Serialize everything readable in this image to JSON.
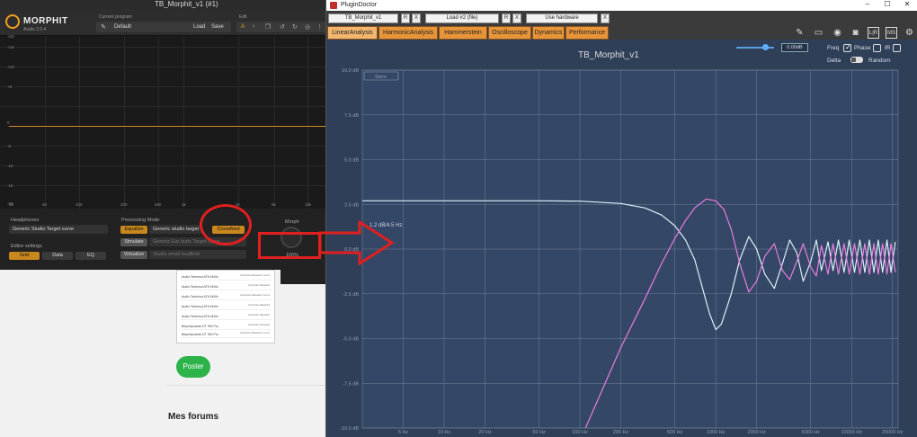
{
  "morphit": {
    "window_title": "TB_Morphit_v1 (#1)",
    "brand": "MORPHIT",
    "version": "Audio 2.0.4",
    "current_program_label": "Current program",
    "program_value": "Default",
    "load_label": "Load",
    "save_label": "Save",
    "edit_label": "Edit",
    "edit_a": "A",
    "graph": {
      "y_labels": [
        "+20",
        "+15",
        "+10",
        "+5",
        "0",
        "-5",
        "-10",
        "-15",
        "-20"
      ],
      "x_labels": [
        "20",
        "50",
        "100",
        "200",
        "500",
        "1k",
        "2k",
        "5k",
        "10k"
      ]
    },
    "headphones_label": "Headphones",
    "headphones_value": "Generic Studio Target curve",
    "processing_mode_label": "Processing Mode",
    "equalize_label": "Equalize",
    "equalize_value": "Generic studio target",
    "crossfeed_label": "Crossfeed",
    "simulate_label": "Simulate",
    "simulate_value": "Generic Ear buds Target curve",
    "virtualize_label": "Virtualize",
    "virtualize_value": "Studio small loudfield",
    "morph_label": "Morph",
    "morph_value": "100%",
    "editor_settings_label": "Editor settings",
    "tab_grid": "Grid",
    "tab_data": "Data",
    "tab_eq": "EQ"
  },
  "web": {
    "rows": [
      {
        "left": "Audio Technica ATH-M40x",
        "right": "hp.forum.thread.4 / rev.2"
      },
      {
        "left": "Audio Technica ATH-M40x",
        "right": "hp.forum.thread.4"
      },
      {
        "left": "Audio Technica ATH-M40x",
        "right": "hp.forum.thread.4 / rev.2"
      },
      {
        "left": "Audio Technica ATH-M40x",
        "right": "hp.forum.thread.4"
      },
      {
        "left": "Audio Technica ATH-M40x",
        "right": "hp.forum.thread.4"
      },
      {
        "left": "Beyerdynamic DT 990 Pro",
        "right": "hp.forum.thread.4"
      },
      {
        "left": "Beyerdynamic DT 990 Pro",
        "right": "hp.forum.thread.4 / rev.2"
      }
    ],
    "poster_button": "Poster",
    "forums_heading": "Mes forums"
  },
  "plugindoctor": {
    "window_title": "PluginDoctor",
    "controls": {
      "minimize": "–",
      "maximize": "☐",
      "close": "✕"
    },
    "toolbar": {
      "plugin_slot": "TB_Morphit_v1",
      "load_slot": "Load #2 (file)",
      "hardware_slot": "Use hardware",
      "r_label": "R",
      "x_label": "X"
    },
    "tabs": [
      "LinearAnalysis",
      "HarmonicAnalysis",
      "Hammerstein",
      "Oscilloscope",
      "Dynamics",
      "Performance"
    ],
    "active_tab": "LinearAnalysis",
    "gain_value": "0.00dB",
    "freq_label": "Freq",
    "phase_label": "Phase",
    "ir_label": "IR",
    "delta_label": "Delta",
    "random_label": "Random",
    "store_label": "Store",
    "plot_title": "TB_Morphit_v1",
    "marker_readout": "1.2 dB/4.5 Hz",
    "icons": [
      "notes-icon",
      "book-icon",
      "eye-icon",
      "camera-icon",
      "lr-icon",
      "ms-icon",
      "gear-icon"
    ],
    "icon_labels": {
      "lr": "L|R",
      "ms": "MS"
    }
  },
  "chart_data": {
    "type": "line",
    "title": "TB_Morphit_v1",
    "xscale": "log",
    "xlim": [
      2.5,
      22000
    ],
    "ylim": [
      -10,
      10
    ],
    "y_ticks": [
      10,
      7.5,
      5,
      2.5,
      0,
      -2.5,
      -5,
      -7.5,
      -10
    ],
    "y_tick_labels": [
      "10.0 dB",
      "7.5 dB",
      "5.0 dB",
      "2.5 dB",
      "0.0 dB",
      "-2.5 dB",
      "-5.0 dB",
      "-7.5 dB",
      "-10.0 dB"
    ],
    "x_ticks": [
      5,
      10,
      20,
      50,
      100,
      200,
      500,
      1000,
      2000,
      5000,
      10000,
      20000
    ],
    "x_tick_labels": [
      "5 Hz",
      "10 Hz",
      "20 Hz",
      "50 Hz",
      "100 Hz",
      "200 Hz",
      "500 Hz",
      "1000 Hz",
      "2000 Hz",
      "5000 Hz",
      "10000 Hz",
      "20000 Hz"
    ],
    "grid": true,
    "series": [
      {
        "color": "#d9f2f8",
        "points": [
          [
            2.5,
            2.7
          ],
          [
            50,
            2.7
          ],
          [
            100,
            2.68
          ],
          [
            200,
            2.55
          ],
          [
            300,
            2.3
          ],
          [
            400,
            1.9
          ],
          [
            500,
            1.3
          ],
          [
            600,
            0.5
          ],
          [
            700,
            -0.6
          ],
          [
            800,
            -2.2
          ],
          [
            900,
            -3.6
          ],
          [
            1000,
            -4.5
          ],
          [
            1100,
            -4.2
          ],
          [
            1300,
            -2.5
          ],
          [
            1500,
            -0.6
          ],
          [
            1750,
            0.7
          ],
          [
            2000,
            0.0
          ],
          [
            2300,
            -1.4
          ],
          [
            2700,
            -2.2
          ],
          [
            3100,
            -0.8
          ],
          [
            3500,
            0.5
          ],
          [
            3950,
            -0.2
          ],
          [
            4400,
            -1.8
          ],
          [
            5000,
            -0.7
          ],
          [
            5500,
            0.5
          ],
          [
            6000,
            -1.2
          ],
          [
            6700,
            0.4
          ],
          [
            7300,
            -1.2
          ],
          [
            8000,
            0.5
          ],
          [
            8800,
            -1.3
          ],
          [
            9600,
            0.5
          ],
          [
            10500,
            -1.3
          ],
          [
            11500,
            0.5
          ],
          [
            12500,
            -1.3
          ],
          [
            13500,
            0.5
          ],
          [
            14600,
            -1.3
          ],
          [
            15700,
            0.5
          ],
          [
            16900,
            -1.3
          ],
          [
            18200,
            0.5
          ],
          [
            19500,
            -1.3
          ],
          [
            21000,
            0.4
          ]
        ]
      },
      {
        "color": "#e87de0",
        "points": [
          [
            110,
            -10
          ],
          [
            200,
            -5.5
          ],
          [
            300,
            -2.8
          ],
          [
            400,
            -0.8
          ],
          [
            500,
            0.6
          ],
          [
            600,
            1.6
          ],
          [
            700,
            2.3
          ],
          [
            850,
            2.8
          ],
          [
            1000,
            2.7
          ],
          [
            1150,
            2.2
          ],
          [
            1300,
            1.1
          ],
          [
            1500,
            -0.8
          ],
          [
            1750,
            -2.4
          ],
          [
            2000,
            -1.8
          ],
          [
            2300,
            -0.4
          ],
          [
            2700,
            0.3
          ],
          [
            3100,
            -1.2
          ],
          [
            3500,
            -1.7
          ],
          [
            3950,
            -0.7
          ],
          [
            4400,
            0.3
          ],
          [
            5000,
            -1.0
          ],
          [
            5500,
            -1.5
          ],
          [
            6000,
            0.2
          ],
          [
            6700,
            -1.4
          ],
          [
            7300,
            0.3
          ],
          [
            8000,
            -1.4
          ],
          [
            8800,
            0.3
          ],
          [
            9600,
            -1.4
          ],
          [
            10500,
            0.3
          ],
          [
            11500,
            -1.4
          ],
          [
            12500,
            0.3
          ],
          [
            13500,
            -1.4
          ],
          [
            14600,
            0.3
          ],
          [
            15700,
            -1.4
          ],
          [
            16900,
            0.3
          ],
          [
            18200,
            -1.4
          ],
          [
            19500,
            0.3
          ],
          [
            21000,
            -1.3
          ]
        ]
      }
    ]
  }
}
